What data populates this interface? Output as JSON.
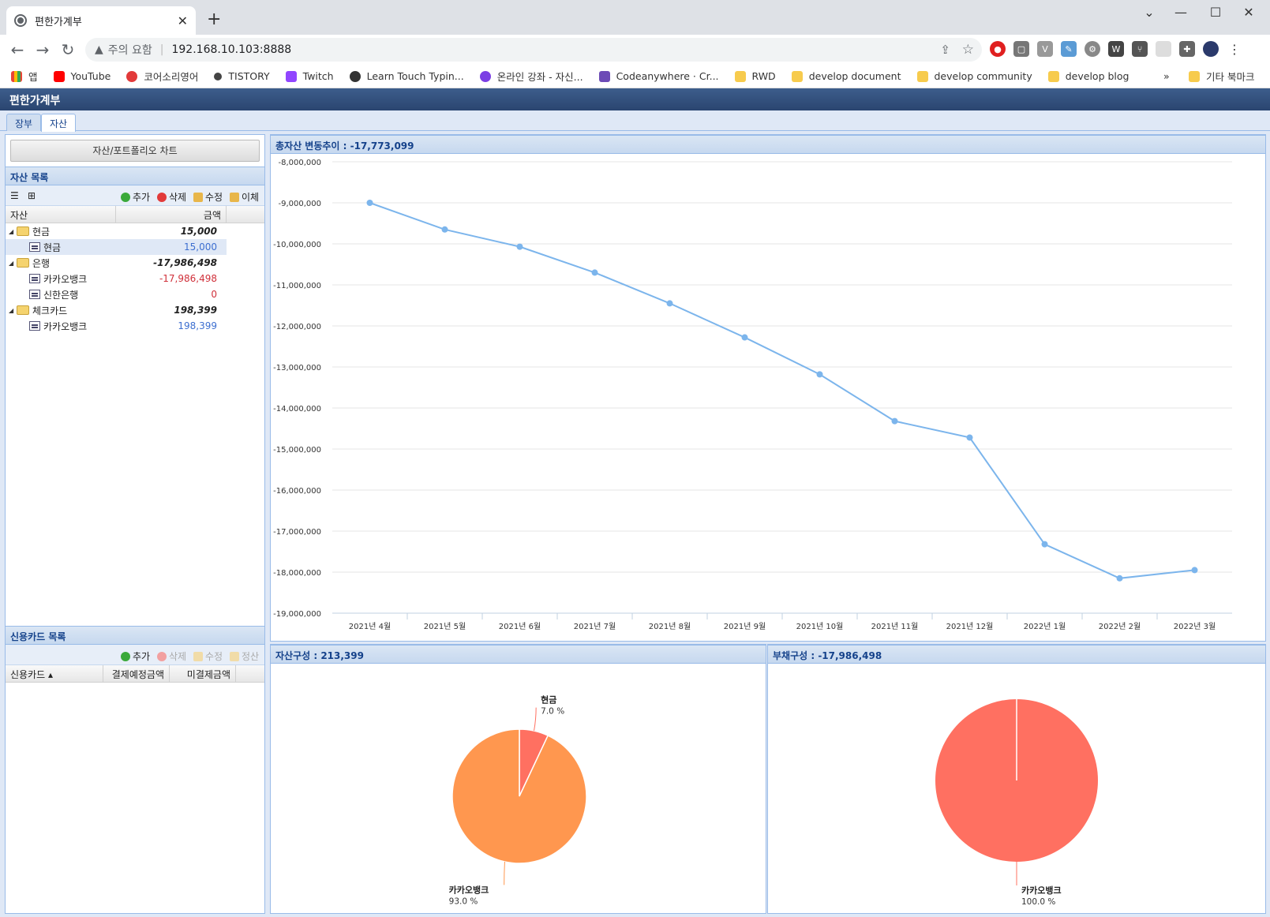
{
  "browser": {
    "tab_title": "편한가계부",
    "security_label": "주의 요함",
    "url": "192.168.10.103:8888",
    "bookmarks": [
      "앱",
      "YouTube",
      "코어소리영어",
      "TISTORY",
      "Twitch",
      "Learn Touch Typin...",
      "온라인 강좌 - 자신...",
      "Codeanywhere · Cr...",
      "RWD",
      "develop document",
      "develop community",
      "develop blog"
    ],
    "bookmarks_more": "»",
    "other_bookmarks": "기타 북마크"
  },
  "app": {
    "title": "편한가계부",
    "tabs": [
      "장부",
      "자산"
    ],
    "active_tab": "자산",
    "chart_button": "자산/포트폴리오 차트"
  },
  "asset_list": {
    "title": "자산 목록",
    "toolbar": {
      "add": "추가",
      "delete": "삭제",
      "edit": "수정",
      "transfer": "이체"
    },
    "columns": [
      "자산",
      "금액"
    ],
    "rows": [
      {
        "name": "현금",
        "amount": "15,000",
        "group": true
      },
      {
        "name": "현금",
        "amount": "15,000",
        "group": false,
        "color": "#3d6fd0"
      },
      {
        "name": "은행",
        "amount": "-17,986,498",
        "group": true
      },
      {
        "name": "카카오뱅크",
        "amount": "-17,986,498",
        "group": false,
        "color": "#d0303a"
      },
      {
        "name": "신한은행",
        "amount": "0",
        "group": false,
        "color": "#d0303a"
      },
      {
        "name": "체크카드",
        "amount": "198,399",
        "group": true
      },
      {
        "name": "카카오뱅크",
        "amount": "198,399",
        "group": false,
        "color": "#3d6fd0"
      }
    ]
  },
  "card_list": {
    "title": "신용카드 목록",
    "toolbar": {
      "add": "추가",
      "delete": "삭제",
      "edit": "수정",
      "settle": "정산"
    },
    "columns": [
      "신용카드 ▴",
      "결제예정금액",
      "미결제금액"
    ]
  },
  "line_panel": {
    "title": "총자산 변동추이 : -17,773,099"
  },
  "asset_pie_panel": {
    "title": "자산구성 : 213,399"
  },
  "debt_pie_panel": {
    "title": "부채구성 : -17,986,498"
  },
  "chart_data": [
    {
      "type": "line",
      "x": [
        "2021년 4월",
        "2021년 5월",
        "2021년 6월",
        "2021년 7월",
        "2021년 8월",
        "2021년 9월",
        "2021년 10월",
        "2021년 11월",
        "2021년 12월",
        "2022년 1월",
        "2022년 2월",
        "2022년 3월"
      ],
      "values": [
        -9000000,
        -9650000,
        -10070000,
        -10700000,
        -11450000,
        -12280000,
        -13180000,
        -14320000,
        -14720000,
        -17320000,
        -18150000,
        -17950000
      ],
      "ylim": [
        -19000000,
        -8000000
      ],
      "yticks": [
        "-8,000,000",
        "-9,000,000",
        "-10,000,000",
        "-11,000,000",
        "-12,000,000",
        "-13,000,000",
        "-14,000,000",
        "-15,000,000",
        "-16,000,000",
        "-17,000,000",
        "-18,000,000",
        "-19,000,000"
      ],
      "color": "#7cb5ec",
      "grid": true
    },
    {
      "type": "pie",
      "slices": [
        {
          "label": "현금",
          "percent_text": "7.0 %",
          "value": 7.0,
          "color": "#ff7061"
        },
        {
          "label": "카카오뱅크",
          "percent_text": "93.0 %",
          "value": 93.0,
          "color": "#ff974f"
        }
      ]
    },
    {
      "type": "pie",
      "slices": [
        {
          "label": "카카오뱅크",
          "percent_text": "100.0 %",
          "value": 100.0,
          "color": "#ff7061"
        }
      ]
    }
  ]
}
